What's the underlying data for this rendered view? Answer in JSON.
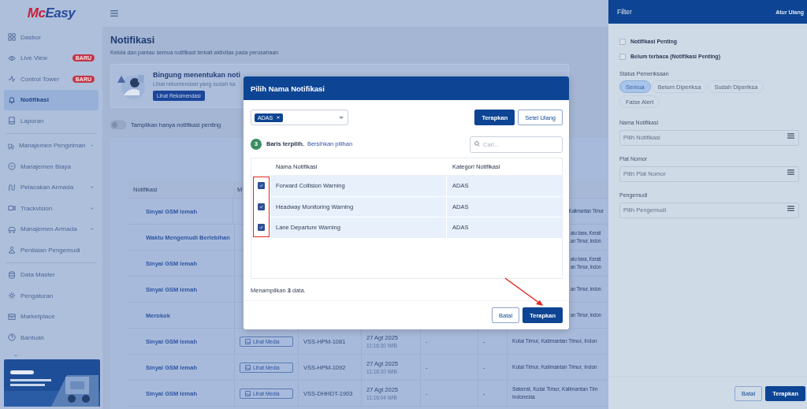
{
  "header": {
    "logo_mc": "Mc",
    "logo_easy": "Easy"
  },
  "sidebar": {
    "groups": [
      {
        "items": [
          {
            "label": "Dasbor",
            "expandable": false,
            "selected": false
          },
          {
            "label": "Live View",
            "badge": "BARU",
            "expandable": false,
            "selected": false
          },
          {
            "label": "Control Tower",
            "badge": "BARU",
            "expandable": false,
            "selected": false
          },
          {
            "label": "Notifikasi",
            "expandable": false,
            "selected": true
          },
          {
            "label": "Laporan",
            "expandable": false,
            "selected": false
          }
        ]
      },
      {
        "items": [
          {
            "label": "Manajemen Pengiriman",
            "expandable": true,
            "selected": false
          },
          {
            "label": "Manajemen Biaya",
            "expandable": false,
            "selected": false
          },
          {
            "label": "Pelacakan Armada",
            "expandable": true,
            "selected": false
          },
          {
            "label": "Trackvision",
            "expandable": true,
            "selected": false
          },
          {
            "label": "Manajemen Armada",
            "expandable": true,
            "selected": false
          },
          {
            "label": "Penilaian Pengemudi",
            "expandable": false,
            "selected": false
          }
        ]
      },
      {
        "items": [
          {
            "label": "Data Master",
            "expandable": false,
            "selected": false
          },
          {
            "label": "Pengaturan",
            "expandable": false,
            "selected": false
          },
          {
            "label": "Marketplace",
            "expandable": false,
            "selected": false
          },
          {
            "label": "Bantuan",
            "expandable": false,
            "selected": false
          }
        ]
      }
    ]
  },
  "main": {
    "title": "Notifikasi",
    "subtitle": "Kelola dan pantau semua notifikasi terkait aktivitas pada perusahaan",
    "banner": {
      "title": "Bingung menentukan noti",
      "text": "Lihat rekomendasi yang sudah ka",
      "button": "Lihat Rekomendasi"
    },
    "toggle": {
      "label": "Tampilkan hanya notifikasi penting",
      "on": false
    },
    "table": {
      "columns": [
        "Notifikasi",
        "M"
      ],
      "rows": [
        {
          "covered": true,
          "notifikasi": "Sinyal GSM lemah",
          "location": [
            "Kalimantan Timur"
          ]
        },
        {
          "covered": true,
          "notifikasi": "Waktu Mengemudi Berlebihan",
          "location": [
            "atu bara, Kerait",
            "an Timur, Indon"
          ]
        },
        {
          "covered": true,
          "notifikasi": "Sinyal GSM lemah",
          "location": [
            "atu bara, Kerait",
            "an Timur, Indon"
          ]
        },
        {
          "covered": true,
          "notifikasi": "Sinyal GSM lemah",
          "location": [
            "an Timur, Indon"
          ]
        },
        {
          "covered": true,
          "notifikasi": "Merokok",
          "location": [
            "an Timur, Indon"
          ]
        },
        {
          "covered": false,
          "notifikasi": "Sinyal GSM lemah",
          "column_2": "Lihat Media",
          "column_3": "VSS-HPM-1081",
          "date": "27 Agt 2025",
          "time": "11:16:30 WIB",
          "column_5": "-",
          "column_6": "-",
          "location": [
            "Kutai Timur, Kalimantan Timur, Indon"
          ]
        },
        {
          "covered": false,
          "notifikasi": "Sinyal GSM lemah",
          "column_2": "Lihat Media",
          "column_3": "VSS-HPM-1092",
          "date": "27 Agt 2025",
          "time": "11:16:20 WIB",
          "column_5": "-",
          "column_6": "-",
          "location": [
            "Kutai Timur, Kalimantan Timur, Indon"
          ]
        },
        {
          "covered": false,
          "notifikasi": "Sinyal GSM lemah",
          "column_2": "Lihat Media",
          "column_3": "VSS-DHHDT-1903",
          "date": "27 Agt 2025",
          "time": "11:16:04 WIB",
          "column_5": "-",
          "column_6": "-",
          "location": [
            "Sekerat, Kutai Timur, Kalimantan Tim",
            "Indonesia"
          ]
        }
      ]
    }
  },
  "modal": {
    "title": "Pilih Nama Notifikasi",
    "chips": [
      "ADAS"
    ],
    "top_buttons": [
      {
        "label": "Terapkan",
        "kind": "primary"
      },
      {
        "label": "Setel Ulang",
        "kind": "outline"
      }
    ],
    "selection": {
      "count": "3",
      "text": "Baris terpilih.",
      "link": "Bersihkan pilihan"
    },
    "search": {
      "placeholder": "Cari..."
    },
    "columns": [
      "Nama Notifikasi",
      "Kategori Notifikasi"
    ],
    "rows": [
      {
        "name": "Forward Collision Warning",
        "category": "ADAS",
        "checked": true
      },
      {
        "name": "Headway Monitoring Warning",
        "category": "ADAS",
        "checked": true
      },
      {
        "name": "Lane Departure Warning",
        "category": "ADAS",
        "checked": true
      }
    ],
    "footer_text": "Menampilkan **3** data.",
    "buttons": [
      {
        "label": "Batal",
        "kind": "outline"
      },
      {
        "label": "Terapkan",
        "kind": "primary"
      }
    ]
  },
  "filter": {
    "title": "Filter",
    "reset": "Atur Ulang",
    "checkboxes": [
      {
        "label": "Notifikasi Penting",
        "checked": false
      },
      {
        "label": "Belum terbaca (Notifikasi Penting)",
        "checked": false
      }
    ],
    "status": {
      "label": "Status Pemeriksaan",
      "chips": [
        {
          "label": "Semua",
          "selected": true
        },
        {
          "label": "Belum Diperiksa",
          "selected": false
        },
        {
          "label": "Sudah Diperiksa",
          "selected": false
        },
        {
          "label": "False Alert",
          "selected": false
        }
      ]
    },
    "fields": [
      {
        "label": "Nama Notifikasi",
        "placeholder": "Pilih Notifikasi"
      },
      {
        "label": "Plat Nomor",
        "placeholder": "Pilih Plat Nomor"
      },
      {
        "label": "Pengemudi",
        "placeholder": "Pilih Pengemudi"
      }
    ],
    "buttons": [
      {
        "label": "Batal",
        "kind": "outline"
      },
      {
        "label": "Terapkan",
        "kind": "primary"
      }
    ]
  }
}
